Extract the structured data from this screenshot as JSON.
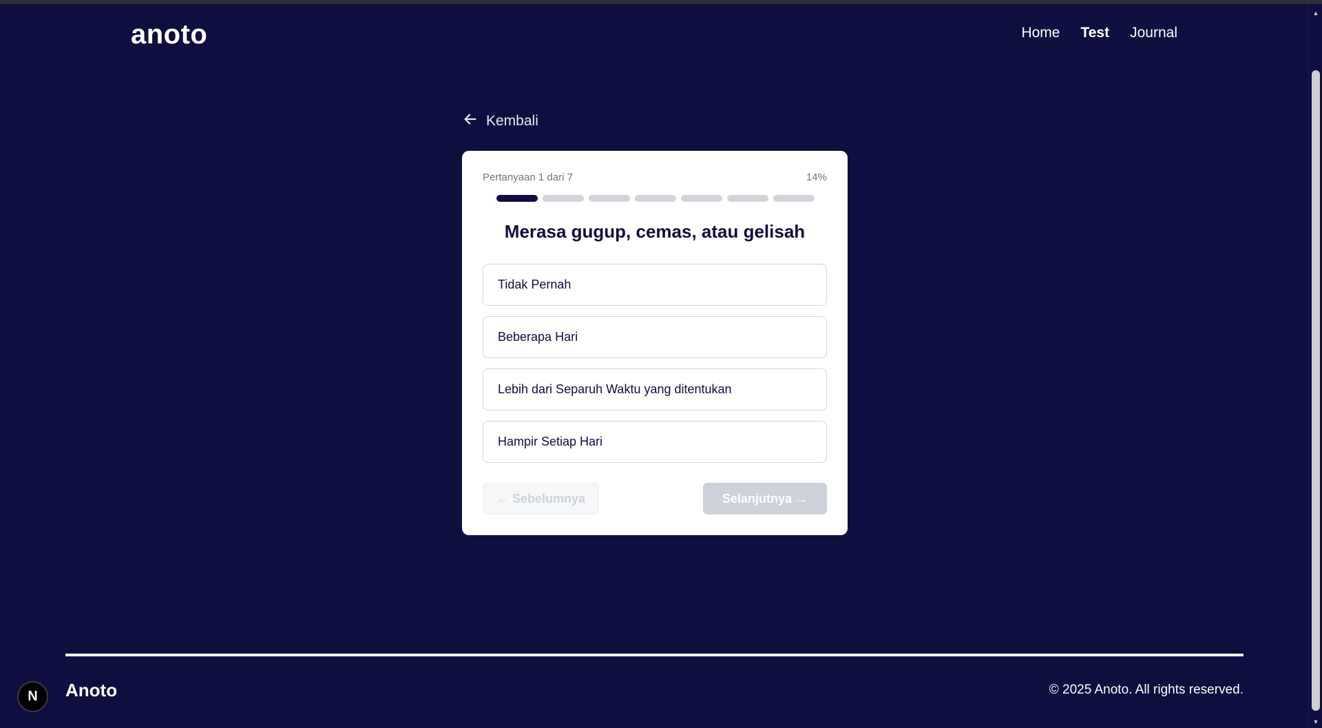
{
  "header": {
    "logo": "anoto",
    "nav": [
      {
        "label": "Home"
      },
      {
        "label": "Test"
      },
      {
        "label": "Journal"
      }
    ]
  },
  "back_label": "Kembali",
  "quiz": {
    "question_counter": "Pertanyaan 1 dari 7",
    "percent": "14%",
    "progress": {
      "current": 1,
      "total": 7
    },
    "question": "Merasa gugup, cemas, atau gelisah",
    "options": [
      {
        "label": "Tidak Pernah"
      },
      {
        "label": "Beberapa Hari"
      },
      {
        "label": "Lebih dari Separuh Waktu yang ditentukan"
      },
      {
        "label": "Hampir Setiap Hari"
      }
    ],
    "prev_label": "← Sebelumnya",
    "next_label": "Selanjutnya →"
  },
  "footer": {
    "brand": "Anoto",
    "copyright": "© 2025 Anoto. All rights reserved."
  },
  "badge_letter": "N",
  "colors": {
    "background": "#0e0f3e",
    "progress_done": "#0e0f3e",
    "progress_todo": "#d1d5db",
    "next_button": "#cdd1d9"
  }
}
